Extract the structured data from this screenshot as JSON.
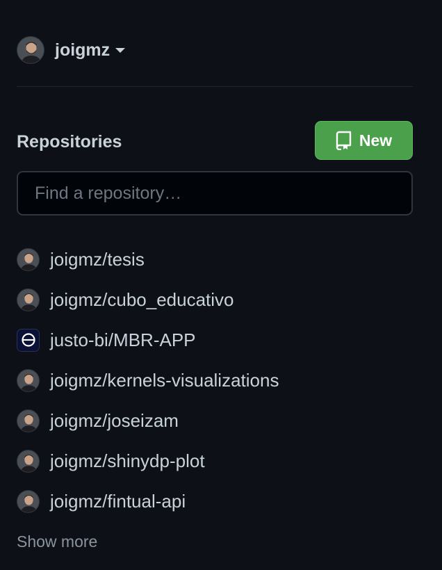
{
  "account": {
    "username": "joigmz",
    "avatar_icon": "user-avatar-icon"
  },
  "repositories": {
    "title": "Repositories",
    "new_button_label": "New",
    "new_button_icon": "repo-icon",
    "search_placeholder": "Find a repository…",
    "items": [
      {
        "name": "joigmz/tesis",
        "avatar": "user"
      },
      {
        "name": "joigmz/cubo_educativo",
        "avatar": "user"
      },
      {
        "name": "justo-bi/MBR-APP",
        "avatar": "org"
      },
      {
        "name": "joigmz/kernels-visualizations",
        "avatar": "user"
      },
      {
        "name": "joigmz/joseizam",
        "avatar": "user"
      },
      {
        "name": "joigmz/shinydp-plot",
        "avatar": "user"
      },
      {
        "name": "joigmz/fintual-api",
        "avatar": "user"
      }
    ],
    "show_more_label": "Show more"
  },
  "colors": {
    "background": "#0d1117",
    "text": "#c9d1d9",
    "muted": "#8b949e",
    "new_button": "#4ba04b",
    "border": "#30363d"
  }
}
